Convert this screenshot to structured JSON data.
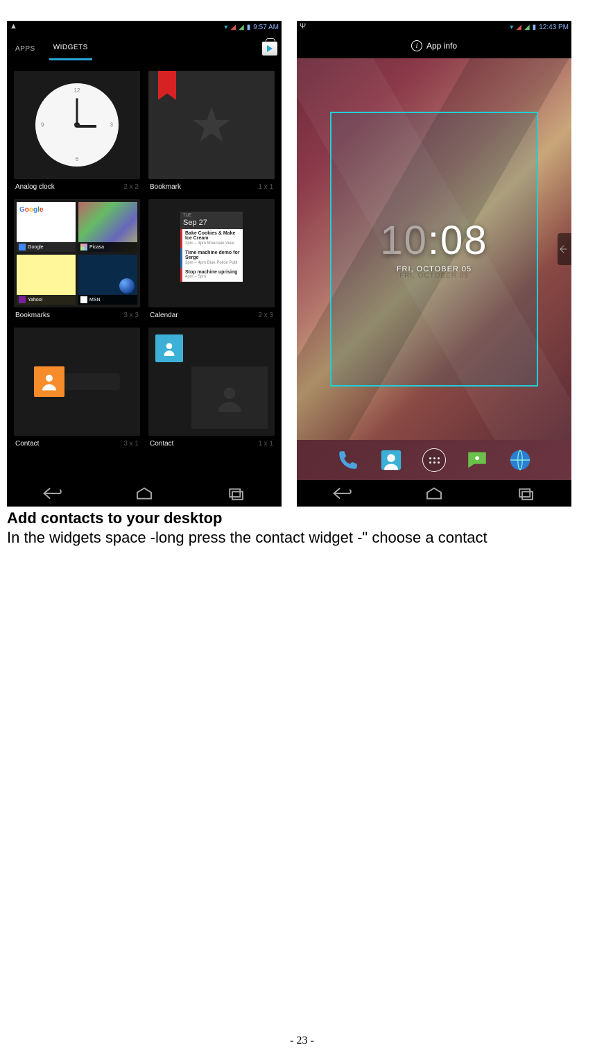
{
  "left_screen": {
    "status": {
      "time": "9:57",
      "ampm": "AM"
    },
    "tabs": {
      "apps": "APPS",
      "widgets": "WIDGETS"
    },
    "widgets": [
      {
        "name": "Analog clock",
        "size": "2 x 2"
      },
      {
        "name": "Bookmark",
        "size": "1 x 1"
      },
      {
        "name": "Bookmarks",
        "size": "3 x 3"
      },
      {
        "name": "Calendar",
        "size": "2 x 3"
      },
      {
        "name": "Contact",
        "size": "3 x 1"
      },
      {
        "name": "Contact",
        "size": "1 x 1"
      }
    ],
    "clock_numbers": {
      "n12": "12",
      "n3": "3",
      "n6": "6",
      "n9": "9"
    },
    "bookmarks_tiles": [
      {
        "label": "Google"
      },
      {
        "label": "Picasa"
      },
      {
        "label": "Yahoo!"
      },
      {
        "label": "MSN"
      }
    ],
    "calendar": {
      "day": "TUE",
      "date": "Sep 27",
      "events": [
        {
          "title": "Bake Cookies & Make Ice Cream",
          "sub": "2pm – 3pm  Mountain View",
          "cls": "r"
        },
        {
          "title": "Time machine demo for Serge",
          "sub": "3pm – 4pm  Blue Police Publ",
          "cls": "b"
        },
        {
          "title": "Stop machine uprising",
          "sub": "4pm – 5pm",
          "cls": "r"
        }
      ]
    }
  },
  "right_screen": {
    "status": {
      "time": "12:43",
      "ampm": "PM"
    },
    "app_info_label": "App info",
    "clock": {
      "hour": "10",
      "sep": ":",
      "min": "08"
    },
    "date": "FRI, OCTOBER 05",
    "date_ghost": "FRI, OCTOBER 05"
  },
  "doc": {
    "heading": "Add contacts to your desktop",
    "body": "In the widgets space -long press the contact widget -\" choose a contact"
  },
  "page_number": "- 23 -"
}
